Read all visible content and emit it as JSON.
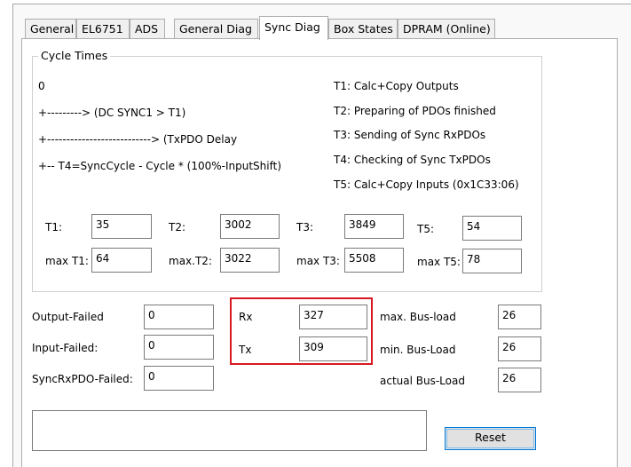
{
  "tabs": [
    {
      "label": "General"
    },
    {
      "label": "EL6751"
    },
    {
      "label": "ADS"
    },
    {
      "label": "General Diag"
    },
    {
      "label": "Sync Diag"
    },
    {
      "label": "Box States"
    },
    {
      "label": "DPRAM (Online)"
    }
  ],
  "active_tab": "Sync Diag",
  "cycle_times": {
    "title": "Cycle Times",
    "diagram_lines": [
      "0",
      "+---------> (DC SYNC1 > T1)",
      "+---------------------------> (TxPDO Delay",
      "+-- T4=SyncCycle - Cycle * (100%-InputShift)"
    ],
    "legend": [
      "T1: Calc+Copy Outputs",
      "T2: Preparing of PDOs finished",
      "T3: Sending of Sync RxPDOs",
      "T4: Checking of Sync TxPDOs",
      "T5: Calc+Copy Inputs (0x1C33:06)"
    ],
    "t1_label": "T1:",
    "t1_value": "35",
    "t2_label": "T2:",
    "t2_value": "3002",
    "t3_label": "T3:",
    "t3_value": "3849",
    "t5_label": "T5:",
    "t5_value": "54",
    "max_t1_label": "max T1:",
    "max_t1_value": "64",
    "max_t2_label": "max.T2:",
    "max_t2_value": "3022",
    "max_t3_label": "max T3:",
    "max_t3_value": "5508",
    "max_t5_label": "max T5:",
    "max_t5_value": "78"
  },
  "failures": {
    "output_failed_label": "Output-Failed",
    "output_failed_value": "0",
    "input_failed_label": "Input-Failed:",
    "input_failed_value": "0",
    "sync_rxpdo_failed_label": "SyncRxPDO-Failed:",
    "sync_rxpdo_failed_value": "0"
  },
  "rxtx": {
    "rx_label": "Rx",
    "rx_value": "327",
    "tx_label": "Tx",
    "tx_value": "309",
    "highlight_color": "#d71921"
  },
  "bus_load": {
    "max_label": "max. Bus-load",
    "max_value": "26",
    "min_label": "min. Bus-Load",
    "min_value": "26",
    "actual_label": "actual Bus-Load",
    "actual_value": "26"
  },
  "message_box_value": "",
  "reset_label": "Reset"
}
